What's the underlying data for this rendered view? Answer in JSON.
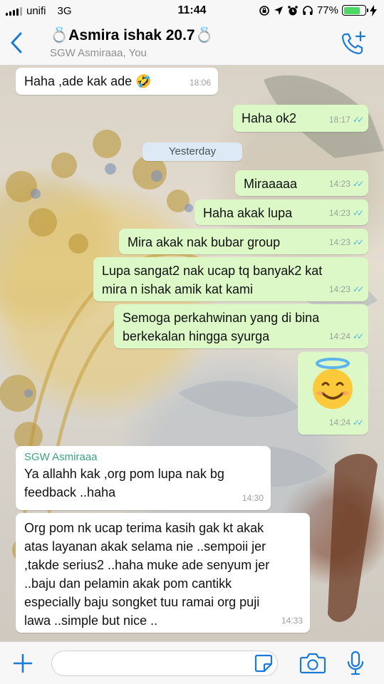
{
  "status_bar": {
    "carrier": "unifi",
    "network": "3G",
    "time": "11:44",
    "battery": "77%",
    "battery_level": 0.77
  },
  "header": {
    "title": "💍Asmira ishak 20.7💍",
    "subtitle": "SGW Asmiraaa, You"
  },
  "date_divider": "Yesterday",
  "messages": [
    {
      "dir": "in",
      "text": "Haha ,ade kak ade 🤣",
      "time": "18:06"
    },
    {
      "dir": "out",
      "text": "Haha ok2",
      "time": "18:17"
    },
    {
      "dir": "out",
      "text": "Miraaaaa",
      "time": "14:23"
    },
    {
      "dir": "out",
      "text": "Haha akak lupa",
      "time": "14:23"
    },
    {
      "dir": "out",
      "text": "Mira akak nak bubar group",
      "time": "14:23"
    },
    {
      "dir": "out",
      "text": "Lupa sangat2 nak ucap tq banyak2 kat mira n ishak amik kat kami",
      "time": "14:23"
    },
    {
      "dir": "out",
      "text": "Semoga perkahwinan yang di bina berkekalan hingga syurga",
      "time": "14:24"
    },
    {
      "dir": "out",
      "text": "😇",
      "time": "14:24"
    },
    {
      "dir": "in",
      "sender": "SGW Asmiraaa",
      "text": "Ya allahh kak ,org pom lupa nak bg feedback ..haha",
      "time": "14:30"
    },
    {
      "dir": "in",
      "text": "Org pom nk ucap terima kasih gak kt akak atas layanan akak selama nie ..sempoii jer ,takde serius2 ..haha muke ade senyum jer ..baju dan pelamin akak pom cantikk especially baju songket tuu ramai org puji lawa ..simple but nice ..",
      "time": "14:33"
    }
  ],
  "colors": {
    "outgoing_bubble": "#dcf8c6",
    "incoming_bubble": "#ffffff",
    "accent": "#1a7bd6",
    "sender_name": "#3aa37e",
    "read_ticks": "#4fb6ec"
  },
  "icons": {
    "back": "chevron-left-icon",
    "call": "add-call-icon",
    "plus": "plus-icon",
    "sticker": "sticker-icon",
    "camera": "camera-icon",
    "mic": "microphone-icon"
  }
}
